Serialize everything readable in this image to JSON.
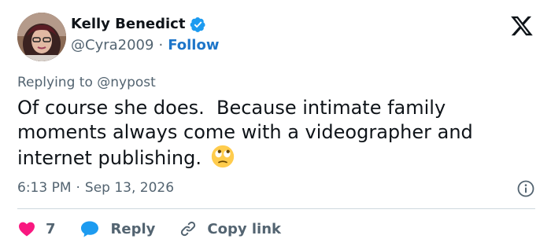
{
  "author": {
    "display_name": "Kelly Benedict",
    "handle": "@Cyra2009",
    "separator": "·",
    "follow_label": "Follow",
    "verified": true
  },
  "icons": {
    "avatar": "profile-photo",
    "verified": "verified-badge-icon",
    "platform": "x-logo-icon",
    "emoji": "face-with-rolling-eyes-emoji",
    "info": "info-icon",
    "like": "heart-icon",
    "reply": "speech-bubble-icon",
    "copy": "link-icon"
  },
  "reply_context": {
    "prefix": "Replying to",
    "mention": "@nypost"
  },
  "tweet": {
    "text": "Of course she does.  Because intimate family moments always come with a videographer and internet publishing."
  },
  "timestamp": {
    "time": "6:13 PM",
    "separator": "·",
    "date": "Sep 13, 2026"
  },
  "actions": {
    "like_count": "7",
    "reply_label": "Reply",
    "copy_label": "Copy link"
  },
  "colors": {
    "like": "#f91880",
    "reply": "#1d9bf0",
    "follow": "#1d75c9",
    "verified": "#1d9bf0",
    "muted": "#536471"
  }
}
